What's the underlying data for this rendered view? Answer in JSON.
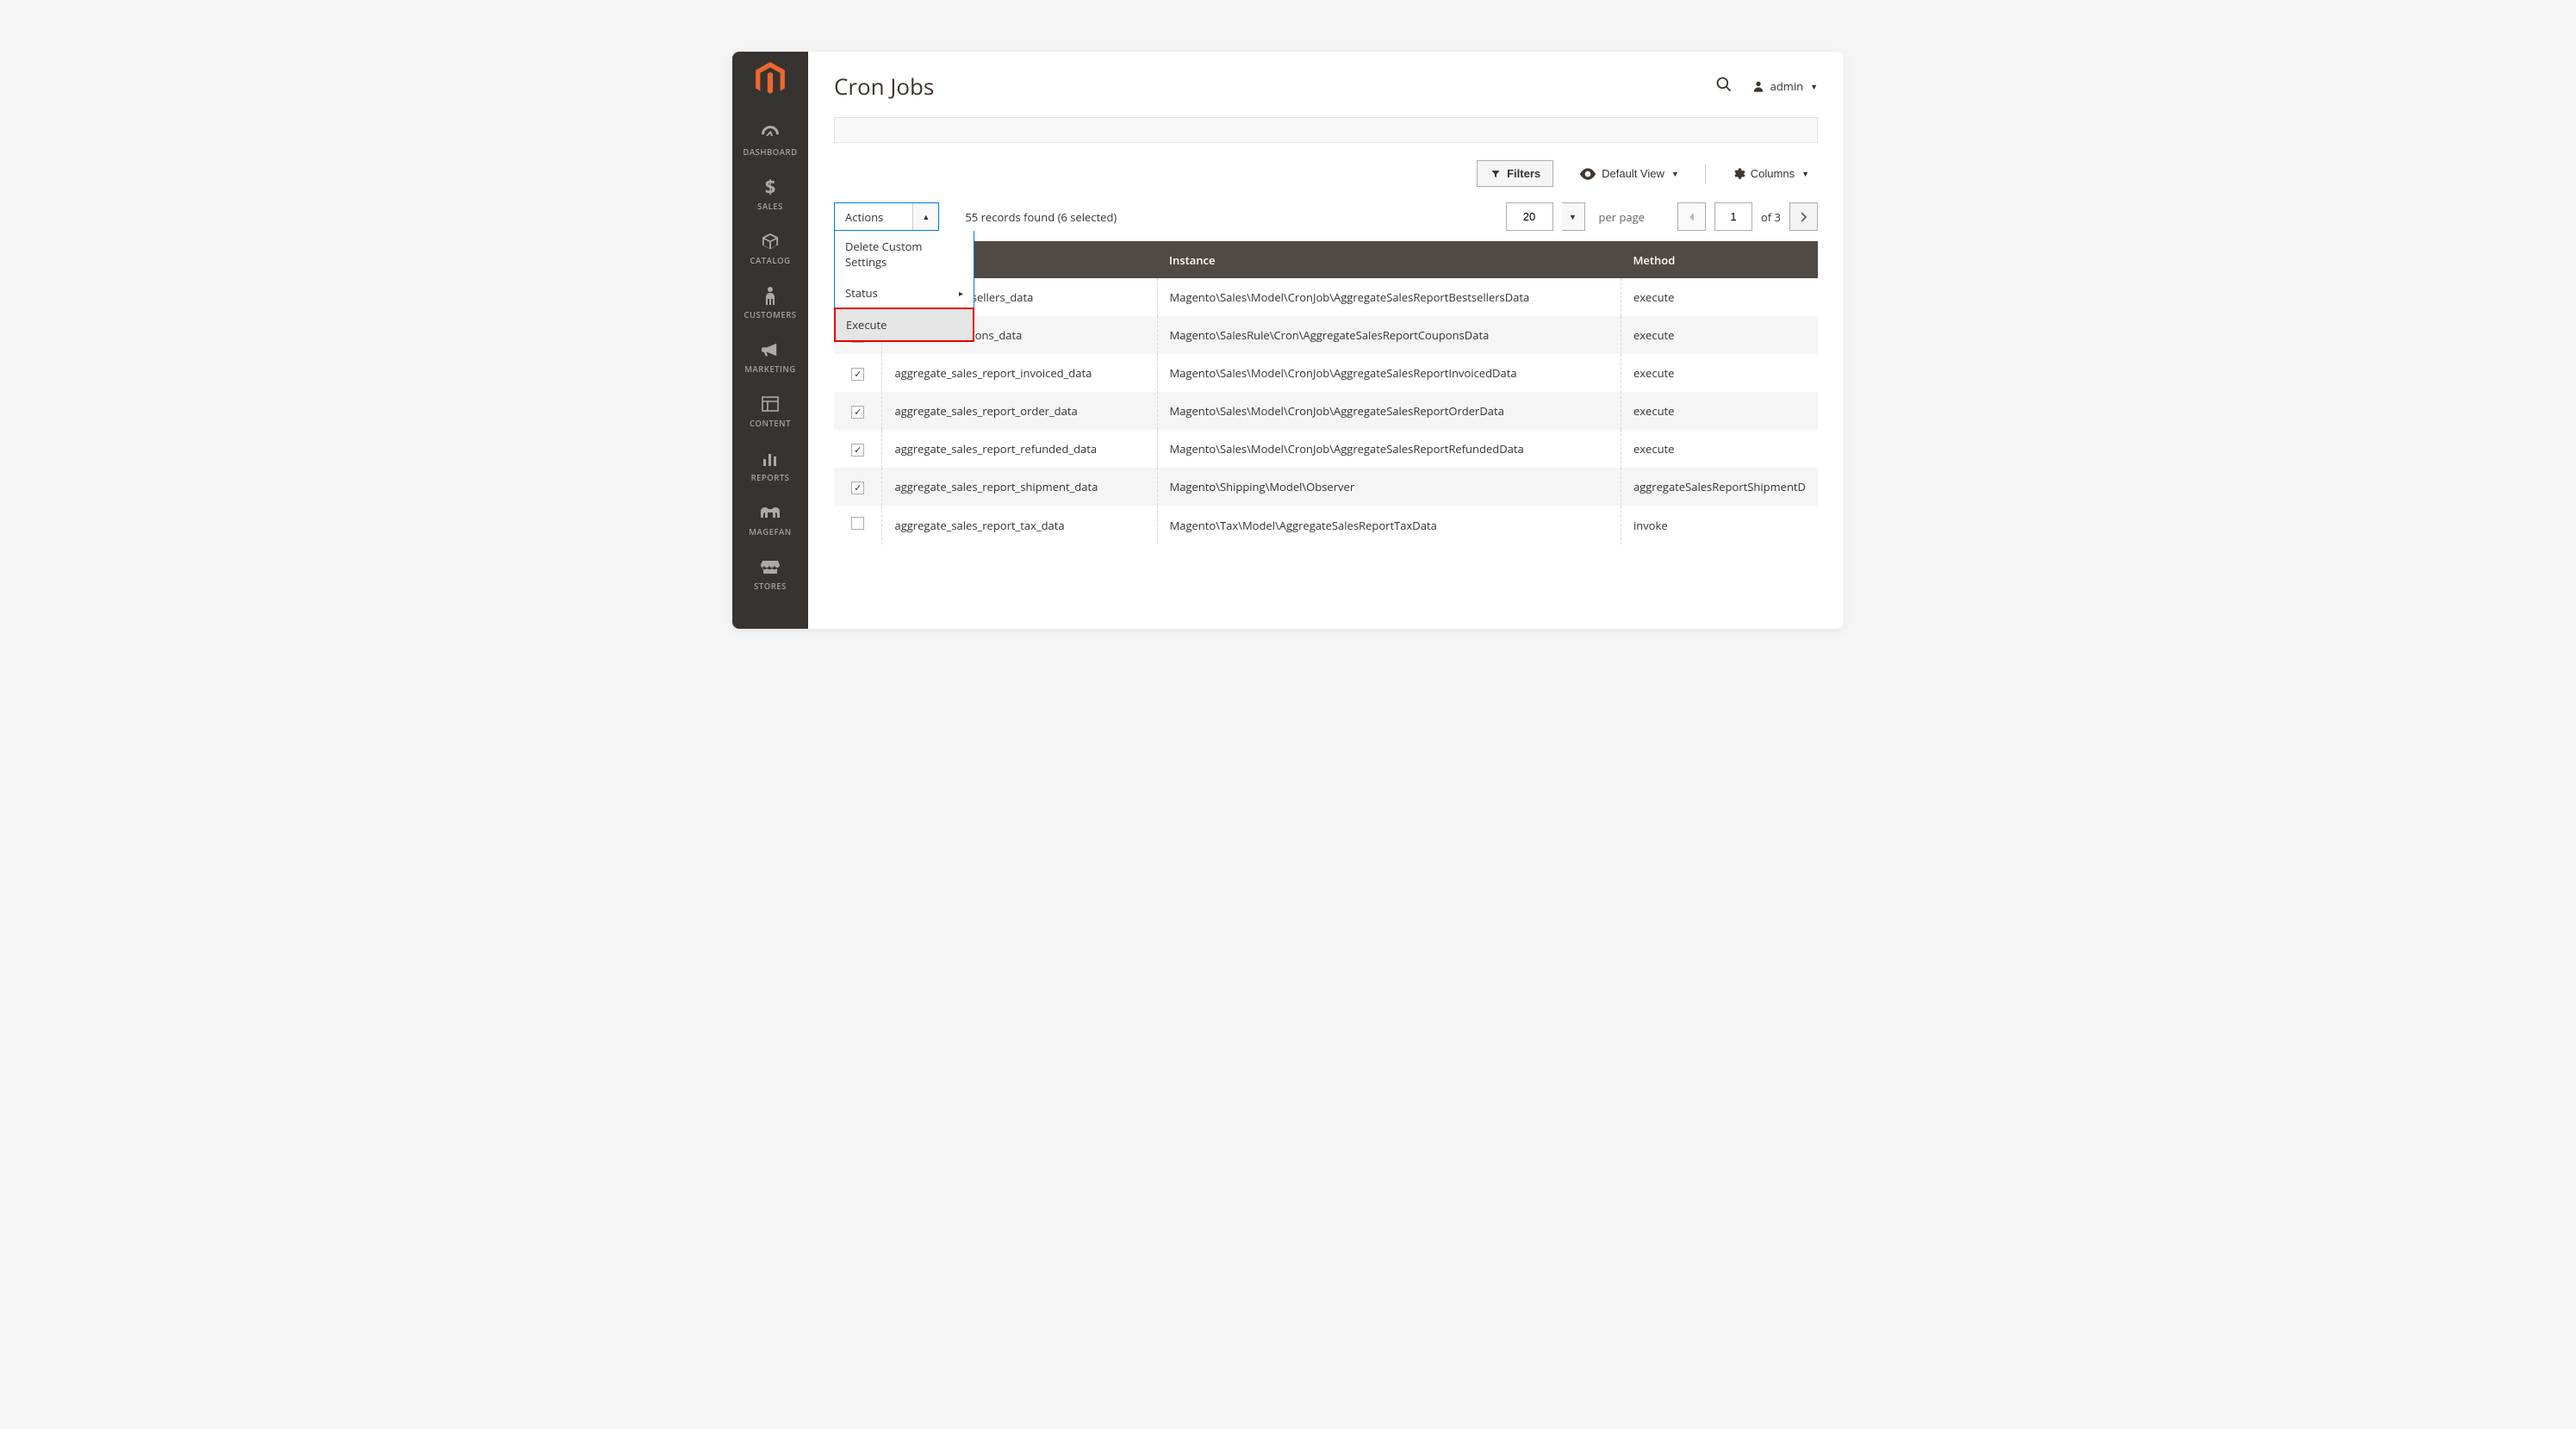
{
  "pageTitle": "Cron Jobs",
  "admin": {
    "label": "admin"
  },
  "sidebar": {
    "items": [
      {
        "label": "DASHBOARD",
        "icon": "dashboard"
      },
      {
        "label": "SALES",
        "icon": "dollar"
      },
      {
        "label": "CATALOG",
        "icon": "box"
      },
      {
        "label": "CUSTOMERS",
        "icon": "person"
      },
      {
        "label": "MARKETING",
        "icon": "megaphone"
      },
      {
        "label": "CONTENT",
        "icon": "layout"
      },
      {
        "label": "REPORTS",
        "icon": "bars"
      },
      {
        "label": "MAGEFAN",
        "icon": "elephant"
      },
      {
        "label": "STORES",
        "icon": "stores"
      }
    ]
  },
  "toolbar": {
    "filters": "Filters",
    "defaultView": "Default View",
    "columns": "Columns"
  },
  "actions": {
    "label": "Actions",
    "items": [
      {
        "label": "Delete Custom Settings",
        "sub": false,
        "hl": false
      },
      {
        "label": "Status",
        "sub": true,
        "hl": false
      },
      {
        "label": "Execute",
        "sub": false,
        "hl": true
      }
    ]
  },
  "records": {
    "text": "55 records found (6 selected)"
  },
  "paging": {
    "pageSize": "20",
    "perPage": "per page",
    "current": "1",
    "of": "of 3"
  },
  "columns": {
    "code": "",
    "instance": "Instance",
    "method": "Method"
  },
  "rows": [
    {
      "checked": true,
      "code": "es_report_bestsellers_data",
      "instance": "Magento\\Sales\\Model\\CronJob\\AggregateSalesReportBestsellersData",
      "method": "execute"
    },
    {
      "checked": true,
      "code": "es_report_coupons_data",
      "instance": "Magento\\SalesRule\\Cron\\AggregateSalesReportCouponsData",
      "method": "execute"
    },
    {
      "checked": true,
      "code": "aggregate_sales_report_invoiced_data",
      "instance": "Magento\\Sales\\Model\\CronJob\\AggregateSalesReportInvoicedData",
      "method": "execute"
    },
    {
      "checked": true,
      "code": "aggregate_sales_report_order_data",
      "instance": "Magento\\Sales\\Model\\CronJob\\AggregateSalesReportOrderData",
      "method": "execute"
    },
    {
      "checked": true,
      "code": "aggregate_sales_report_refunded_data",
      "instance": "Magento\\Sales\\Model\\CronJob\\AggregateSalesReportRefundedData",
      "method": "execute"
    },
    {
      "checked": true,
      "code": "aggregate_sales_report_shipment_data",
      "instance": "Magento\\Shipping\\Model\\Observer",
      "method": "aggregateSalesReportShipmentD"
    },
    {
      "checked": false,
      "code": "aggregate_sales_report_tax_data",
      "instance": "Magento\\Tax\\Model\\AggregateSalesReportTaxData",
      "method": "invoke"
    }
  ]
}
